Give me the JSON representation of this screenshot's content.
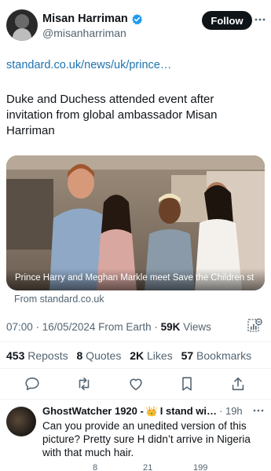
{
  "author": {
    "display_name": "Misan Harriman",
    "handle": "@misanharriman",
    "verified": true,
    "follow_label": "Follow"
  },
  "tweet": {
    "link": "standard.co.uk/news/uk/prince…",
    "text": "Duke and Duchess attended event after invitation from global ambassador Misan Harriman",
    "media_caption": "Prince Harry and Meghan Markle meet Save the Children st...",
    "source": "From standard.co.uk",
    "time": "07:00 · 16/05/2024 From Earth · ",
    "views_count": "59K",
    "views_label": " Views"
  },
  "stats": {
    "reposts_count": "453",
    "reposts_label": " Reposts",
    "quotes_count": "8",
    "quotes_label": " Quotes",
    "likes_count": "2K",
    "likes_label": " Likes",
    "bookmarks_count": "57",
    "bookmarks_label": " Bookmarks"
  },
  "reply": {
    "name": "GhostWatcher 1920 -",
    "crown": "👑",
    "sub": "I stand wi…",
    "time": "· 19h",
    "text": "Can you provide an unedited version of this picture?  Pretty sure H didn’t arrive in Nigeria with that much hair.",
    "reply_count": "",
    "repost_count": "8",
    "like_count": "21",
    "views_count": "199"
  },
  "colors": {
    "link": "#1d73b0",
    "text": "#0f1419",
    "muted": "#536471",
    "button_bg": "#0f1419",
    "verified": "#1d9bf0"
  },
  "icons": [
    "verified-badge-icon",
    "more-icon",
    "analytics-icon",
    "reply-icon",
    "repost-icon",
    "like-icon",
    "bookmark-icon",
    "share-icon"
  ]
}
